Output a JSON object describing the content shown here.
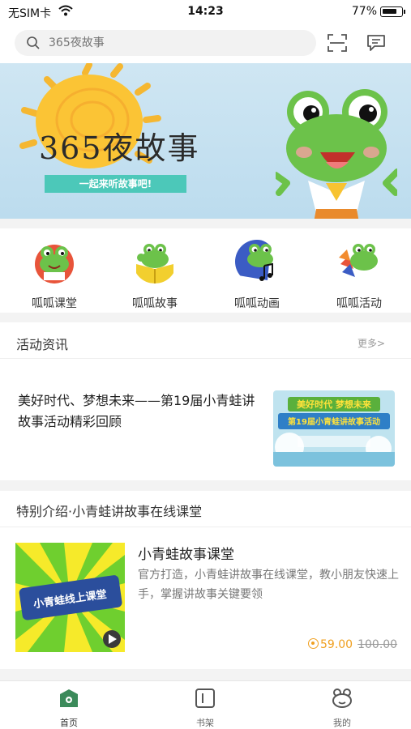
{
  "status_bar": {
    "carrier": "无SIM卡",
    "time": "14:23",
    "battery": "77%"
  },
  "search": {
    "placeholder": "365夜故事"
  },
  "banner": {
    "title": "365夜故事",
    "subtitle": "一起来听故事吧!"
  },
  "categories": [
    {
      "label": "呱呱课堂",
      "icon": "frog-classroom-icon",
      "color": "#e8543a"
    },
    {
      "label": "呱呱故事",
      "icon": "frog-story-icon",
      "color": "#f2cf2e"
    },
    {
      "label": "呱呱动画",
      "icon": "frog-animation-icon",
      "color": "#3b5cc4"
    },
    {
      "label": "呱呱活动",
      "icon": "frog-activity-icon",
      "color": "#f28b2e"
    }
  ],
  "news": {
    "section_title": "活动资讯",
    "more": "更多>",
    "item_title": "美好时代、梦想未来——第19届小青蛙讲故事活动精彩回顾",
    "thumb_top": "美好时代 梦想未来",
    "thumb_bottom": "第19届小青蛙讲故事活动"
  },
  "course": {
    "section_title": "特别介绍·小青蛙讲故事在线课堂",
    "name": "小青蛙故事课堂",
    "description": "官方打造，小青蛙讲故事在线课堂，教小朋友快速上手，掌握讲故事关键要领",
    "price": "59.00",
    "original_price": "100.00",
    "thumb_label": "小青蛙线上课堂"
  },
  "tabs": [
    {
      "label": "首页",
      "icon": "home-icon",
      "active": true
    },
    {
      "label": "书架",
      "icon": "bookshelf-icon",
      "active": false
    },
    {
      "label": "我的",
      "icon": "profile-icon",
      "active": false
    }
  ],
  "colors": {
    "accent_green": "#3b8a5a",
    "price_orange": "#f0a020",
    "banner_sky": "#cfe6f3",
    "frog_green": "#5fbf3a"
  }
}
